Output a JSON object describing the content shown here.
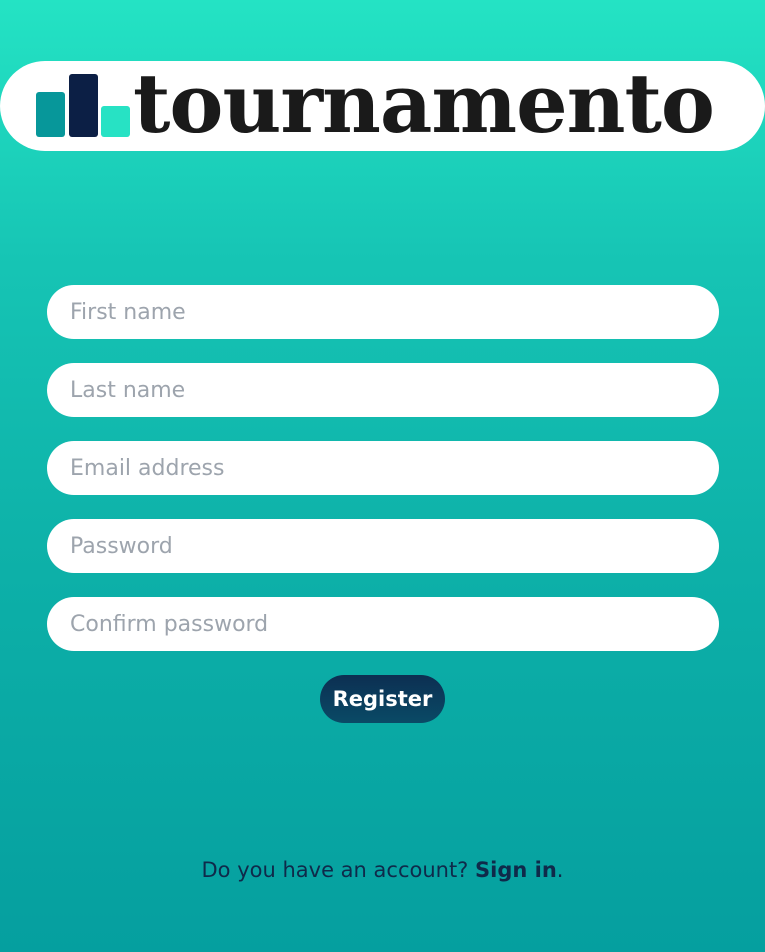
{
  "brand": {
    "name": "tournamento",
    "logo_icon": "bar-chart-icon",
    "colors": {
      "bar_teal": "#07979a",
      "bar_navy": "#0c1f45",
      "bar_mint": "#27e2c4"
    }
  },
  "form": {
    "first_name": {
      "placeholder": "First name",
      "value": ""
    },
    "last_name": {
      "placeholder": "Last name",
      "value": ""
    },
    "email": {
      "placeholder": "Email address",
      "value": ""
    },
    "password": {
      "placeholder": "Password",
      "value": ""
    },
    "confirm_password": {
      "placeholder": "Confirm password",
      "value": ""
    },
    "submit_label": "Register"
  },
  "footer": {
    "prompt": "Do you have an account? ",
    "link_label": "Sign in",
    "suffix": "."
  },
  "theme": {
    "background_top": "#24e3c4",
    "background_bottom": "#059f9f",
    "button_color": "#0c2f52",
    "text_color": "#0f2a4a"
  }
}
